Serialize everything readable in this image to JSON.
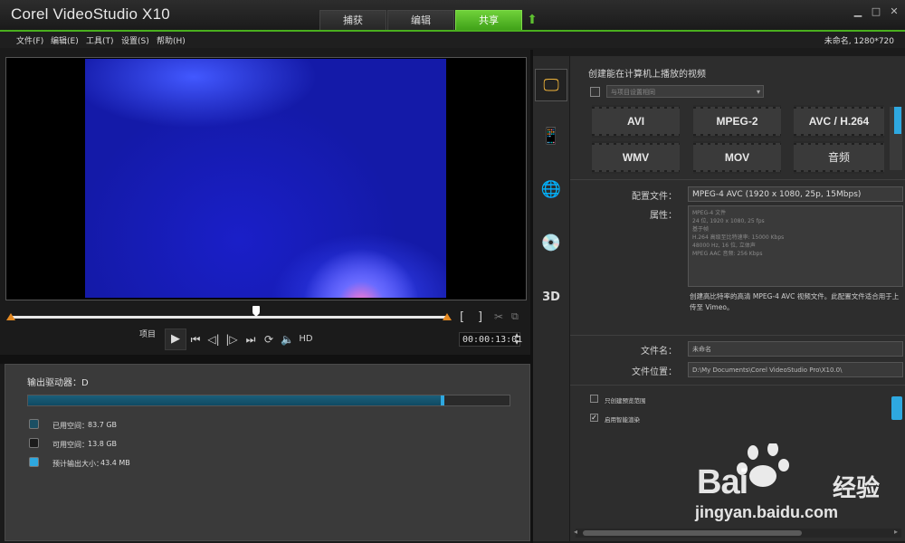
{
  "app": {
    "title": "Corel VideoStudio X10",
    "tabs": [
      {
        "label": "捕获",
        "active": false
      },
      {
        "label": "编辑",
        "active": false
      },
      {
        "label": "共享",
        "active": true
      }
    ],
    "window_controls": [
      "▁",
      "□",
      "✕"
    ]
  },
  "menu": {
    "items": [
      "文件(F)",
      "编辑(E)",
      "工具(T)",
      "设置(S)",
      "帮助(H)"
    ],
    "project_info": "未命名, 1280*720"
  },
  "player": {
    "project_label": "项目",
    "hd_label": "HD",
    "timecode": "00:00:13:01",
    "mark_in": "[",
    "mark_out": "]"
  },
  "drive": {
    "label": "输出驱动器：D",
    "used_fraction": 0.86,
    "legend": [
      {
        "label": "已用空间：",
        "value": "83.7 GB",
        "color": "#1b4f63"
      },
      {
        "label": "可用空间：",
        "value": "13.8 GB",
        "color": "#1c1c1c"
      },
      {
        "label": "预计输出大小：",
        "value": "43.4 MB",
        "color": "#2ea8e0"
      }
    ]
  },
  "share": {
    "heading": "创建能在计算机上播放的视频",
    "preset_placeholder": "与项目设置相同",
    "formats": [
      "AVI",
      "MPEG-2",
      "AVC / H.264",
      "WMV",
      "MOV",
      "音频"
    ],
    "profile_label": "配置文件：",
    "profile_value": "MPEG-4 AVC (1920 x 1080, 25p, 15Mbps)",
    "props_label": "属性：",
    "props": [
      "MPEG-4 文件",
      "24 位, 1920 x 1080, 25 fps",
      "基于帧",
      "H.264 高级至比特速率: 15000 Kbps",
      "48000 Hz, 16 位, 立体声",
      "MPEG AAC 音频: 256 Kbps"
    ],
    "description": "创建高比特率的高清 MPEG-4 AVC 视频文件。此配置文件适合用于上传至 Vimeo。",
    "filename_label": "文件名：",
    "filename_value": "未命名",
    "filepath_label": "文件位置：",
    "filepath_value": "D:\\My Documents\\Corel VideoStudio Pro\\X10.0\\",
    "options": [
      {
        "label": "只创建预览范围",
        "checked": false
      },
      {
        "label": "启用智能渲染",
        "checked": true
      }
    ]
  },
  "watermark": {
    "brand": "Bai",
    "brand_cn": "经验",
    "url": "jingyan.baidu.com"
  }
}
